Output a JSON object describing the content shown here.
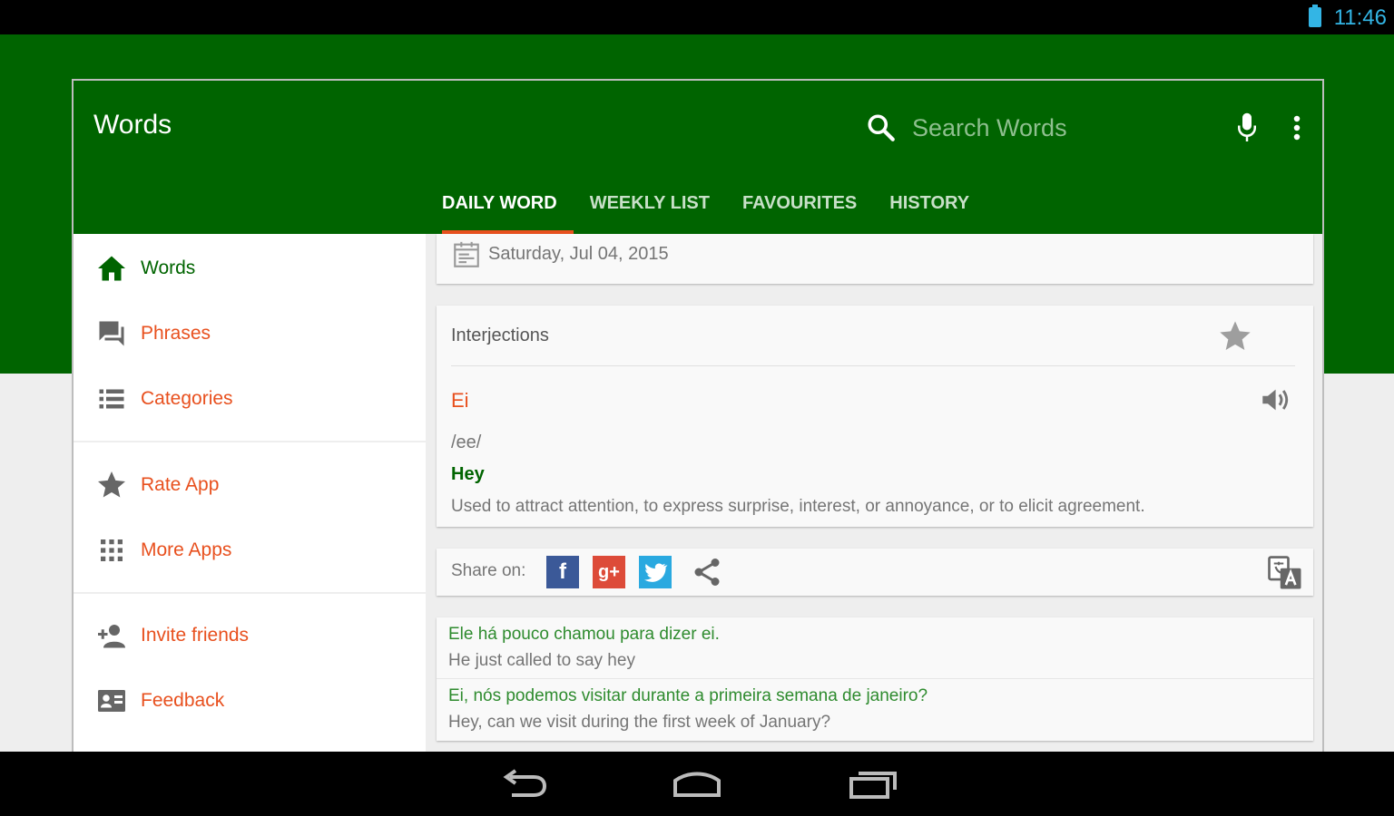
{
  "status_bar": {
    "time": "11:46"
  },
  "app_bar": {
    "title": "Words",
    "search_placeholder": "Search Words"
  },
  "tabs": [
    {
      "label": "DAILY WORD",
      "active": true
    },
    {
      "label": "WEEKLY LIST",
      "active": false
    },
    {
      "label": "FAVOURITES",
      "active": false
    },
    {
      "label": "HISTORY",
      "active": false
    }
  ],
  "drawer": {
    "items": [
      {
        "label": "Words",
        "icon": "home-icon",
        "active": true
      },
      {
        "label": "Phrases",
        "icon": "chat-icon"
      },
      {
        "label": "Categories",
        "icon": "list-icon"
      },
      {
        "label": "Rate App",
        "icon": "star-icon"
      },
      {
        "label": "More Apps",
        "icon": "grid-icon"
      },
      {
        "label": "Invite friends",
        "icon": "add-person-icon"
      },
      {
        "label": "Feedback",
        "icon": "feedback-icon"
      }
    ]
  },
  "daily": {
    "date": "Saturday, Jul 04, 2015",
    "category": "Interjections",
    "word": "Ei",
    "pronunciation": "/ee/",
    "translation": "Hey",
    "definition": "Used to attract attention, to express surprise, interest, or annoyance, or to elicit agreement."
  },
  "share": {
    "label": "Share on:",
    "fb_glyph": "f",
    "gp_glyph": "g+"
  },
  "examples": [
    {
      "pt": "Ele há pouco chamou para dizer ei.",
      "en": "He just called to say hey"
    },
    {
      "pt": "Ei, nós podemos visitar durante a primeira semana de janeiro?",
      "en": "Hey, can we visit during the first week of January?"
    }
  ],
  "colors": {
    "primary": "#006400",
    "accent": "#e8501e",
    "example_text": "#2e8b2e"
  }
}
